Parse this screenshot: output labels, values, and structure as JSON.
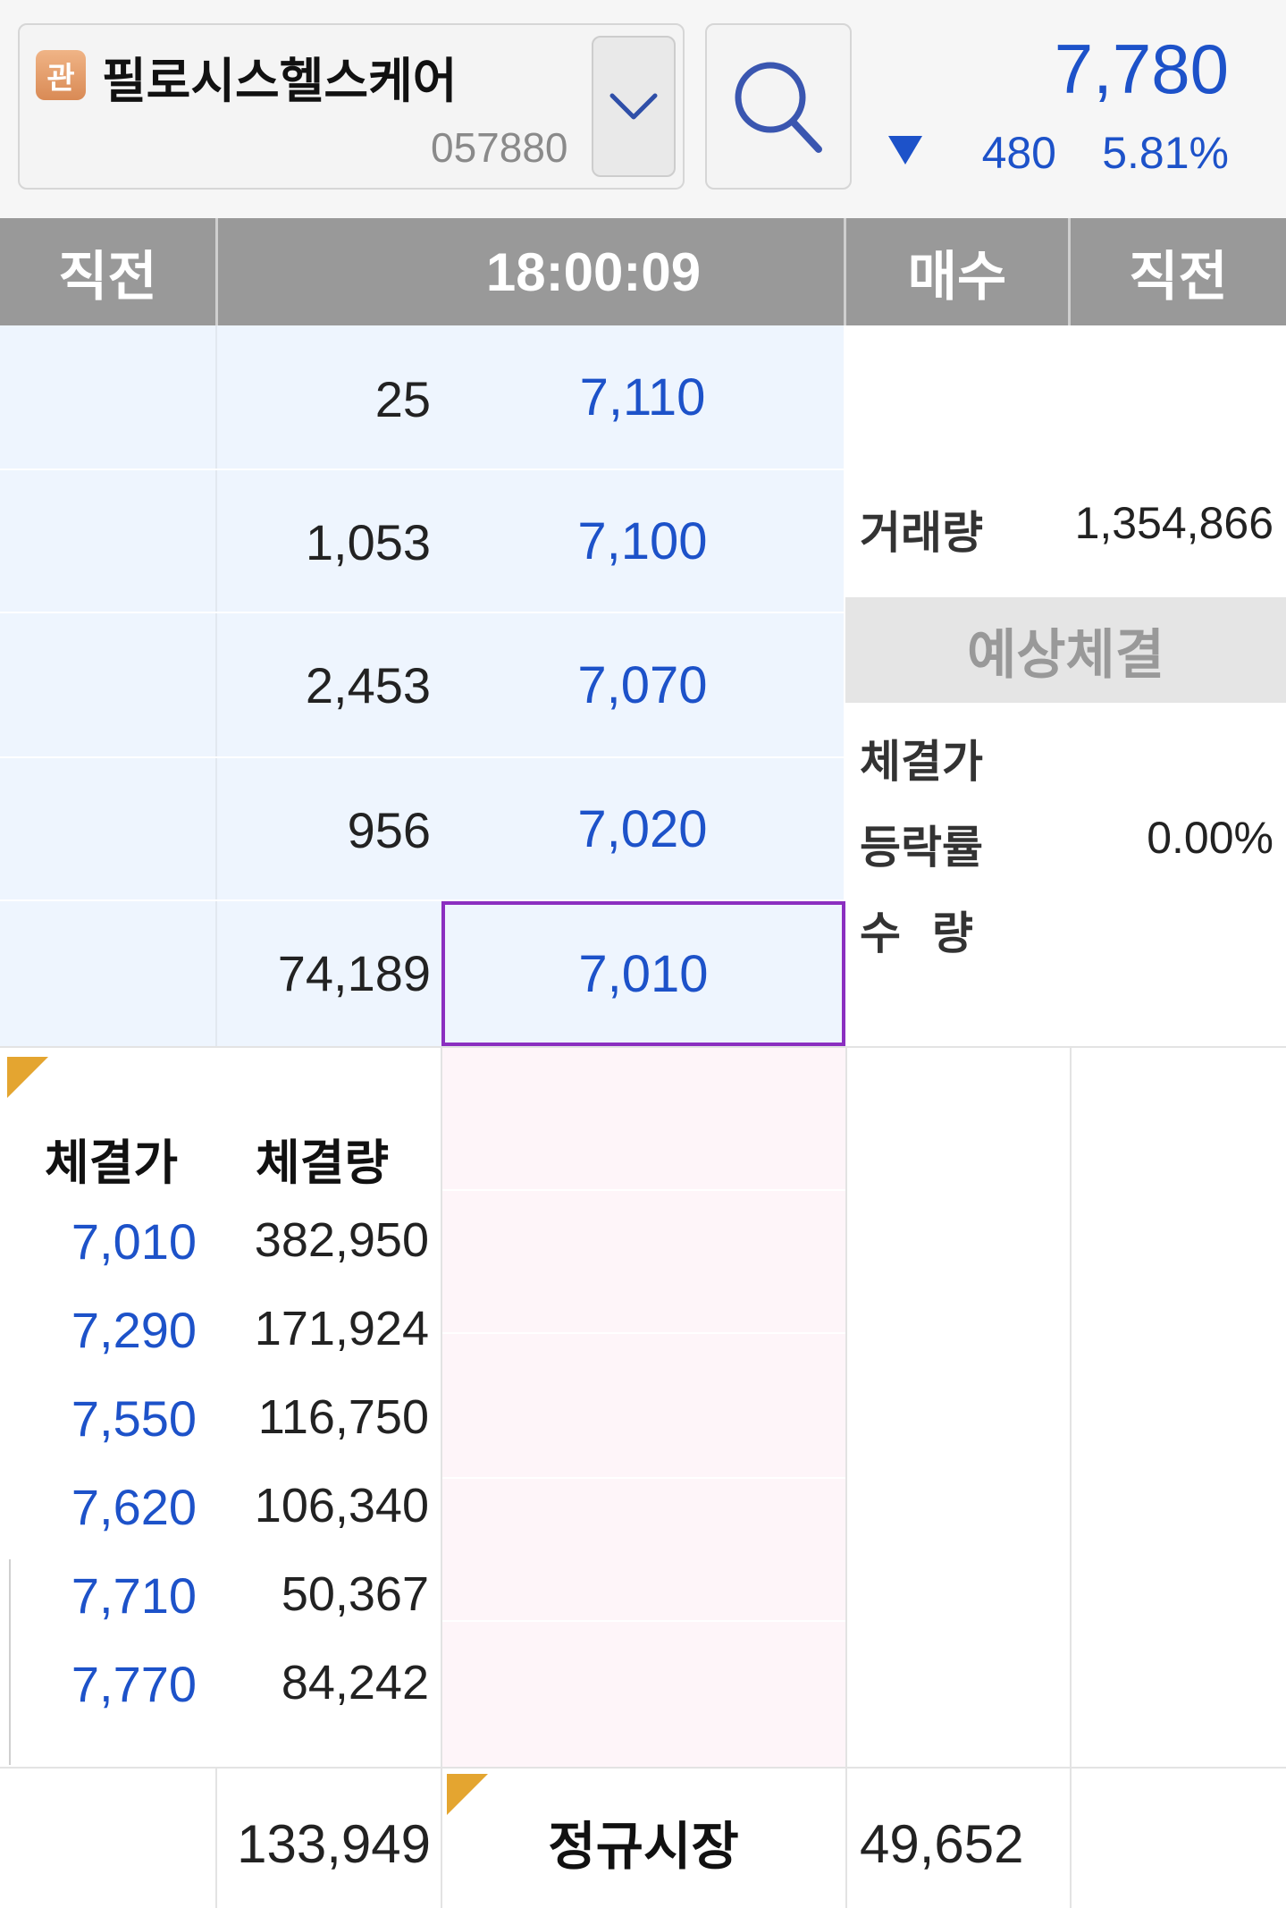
{
  "header": {
    "badge": "관",
    "stock_name": "필로시스헬스케어",
    "stock_code": "057880",
    "price": "7,780",
    "change": "480",
    "change_rate": "5.81%",
    "direction": "down",
    "icons": {
      "dropdown": "chevron-down-icon",
      "search": "search-icon",
      "direction": "down-triangle-icon"
    }
  },
  "columns": {
    "prev_left": "직전",
    "time": "18:00:09",
    "buy": "매수",
    "prev_right": "직전"
  },
  "asks": [
    {
      "qty": "25",
      "price": "7,110"
    },
    {
      "qty": "1,053",
      "price": "7,100"
    },
    {
      "qty": "2,453",
      "price": "7,070"
    },
    {
      "qty": "956",
      "price": "7,020"
    },
    {
      "qty": "74,189",
      "price": "7,010",
      "selected": true
    }
  ],
  "info": {
    "volume_label": "거래량",
    "volume_value": "1,354,866",
    "expected_title": "예상체결",
    "exp_price_label": "체결가",
    "exp_rate_label": "등락률",
    "exp_rate_value": "0.00%",
    "exp_qty_label": "수  량"
  },
  "trades": {
    "price_header": "체결가",
    "volume_header": "체결량",
    "rows": [
      {
        "price": "7,010",
        "volume": "382,950"
      },
      {
        "price": "7,290",
        "volume": "171,924"
      },
      {
        "price": "7,550",
        "volume": "116,750"
      },
      {
        "price": "7,620",
        "volume": "106,340"
      },
      {
        "price": "7,710",
        "volume": "50,367"
      },
      {
        "price": "7,770",
        "volume": "84,242"
      }
    ]
  },
  "bottom": {
    "sell_total": "133,949",
    "session_label": "정규시장",
    "buy_total": "49,652"
  },
  "colors": {
    "accent_blue": "#1d52c9",
    "header_gray": "#999999",
    "ask_bg": "#eef5fe",
    "bid_bg": "#fef5f9",
    "selected_border": "#8b2fc0",
    "corner_marker": "#e4a530"
  }
}
